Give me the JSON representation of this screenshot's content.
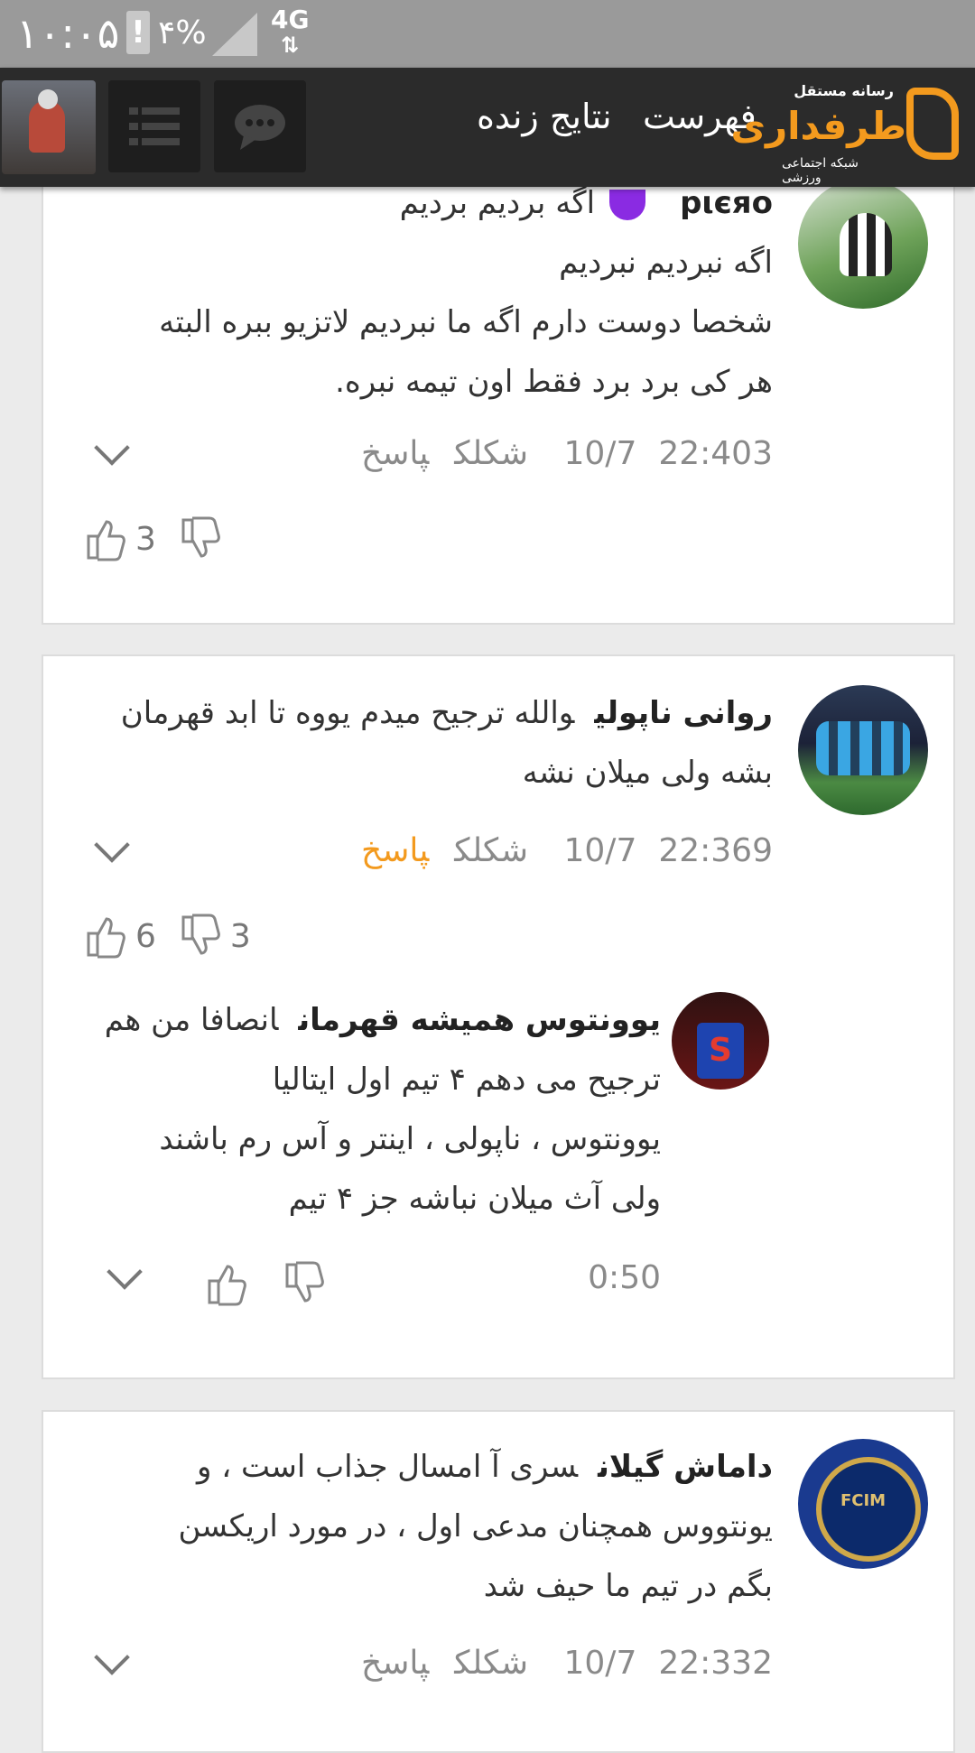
{
  "status_bar": {
    "time": "۱۰:۰۵",
    "alert": "!",
    "battery": "۴%",
    "network": "4G",
    "network_arrows": "⇅"
  },
  "nav": {
    "live_results": "نتایج زنده",
    "list": "فهرست",
    "logo_top": "رسانه مستقل",
    "logo_brand": "طرفداری",
    "logo_sub": "شبکه اجتماعی ورزشی"
  },
  "comments": [
    {
      "user": "pιєяo",
      "lines": [
        "اگه بردیم بردیم",
        "اگه نبردیم نبردیم",
        "شخصا دوست دارم اگه ما نبردیم لاتزیو ببره البته",
        "هر کی برد برد فقط اون تیمه نبره."
      ],
      "date": "10/7",
      "time": "22:40",
      "likes_text": "3 شکلک",
      "reply": "پاسخ",
      "up": "3",
      "down": ""
    },
    {
      "user": "روانی ناپولی",
      "lines": [
        "والله ترجیح میدم یووه تا ابد قهرمان",
        "بشه ولی میلان نشه"
      ],
      "date": "10/7",
      "time": "22:36",
      "likes_text": "9 شکلک",
      "reply": "پاسخ",
      "up": "6",
      "down": "3"
    },
    {
      "user": "یوونتوس همیشه قهرمان",
      "lines": [
        "انصافا من هم",
        "ترجیح می دهم ۴ تیم اول ایتالیا",
        "یوونتوس ، ناپولی ، اینتر و آس رم باشند",
        "ولی آث میلان نباشه جز ۴ تیم"
      ],
      "time": "0:50"
    },
    {
      "user": "داماش گیلان",
      "lines": [
        "سری آ امسال جذاب است ، و",
        "یونتووس همچنان مدعی اول ، در مورد اریکسن",
        "بگم در تیم ما حیف شد"
      ],
      "date": "10/7",
      "time": "22:33",
      "likes_text": "2 شکلک",
      "reply": "پاسخ"
    }
  ]
}
